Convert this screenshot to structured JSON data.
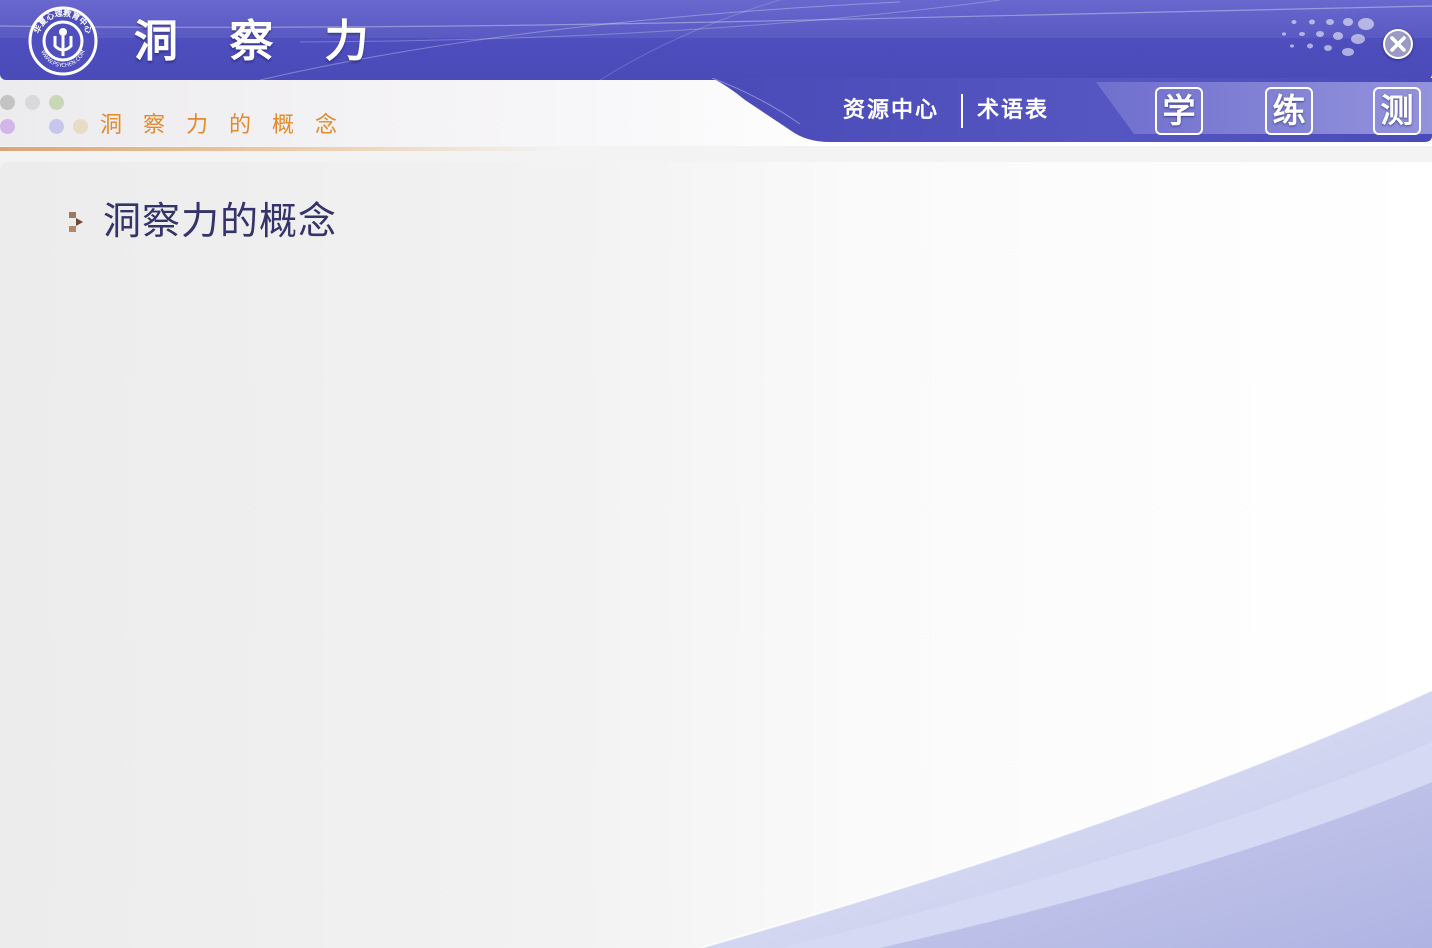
{
  "header": {
    "title": "洞 察 力",
    "logo_text_top": "华夏心理教育中心",
    "logo_text_bottom": "WWW.PSYCHEN.COM",
    "close_icon": "close-icon"
  },
  "subheader": {
    "section_title": "洞 察 力 的 概 念",
    "nav": {
      "resources": "资源中心",
      "glossary": "术语表"
    },
    "modes": [
      "学",
      "练",
      "测"
    ]
  },
  "content": {
    "bullet_icon": "arrow-bullet-icon",
    "heading": "洞察力的概念"
  },
  "colors": {
    "header_blue": "#4d4dbd",
    "section_title_orange": "#e48a2c",
    "heading_text": "#34346a",
    "wave_lavender": "#b9bde6"
  }
}
